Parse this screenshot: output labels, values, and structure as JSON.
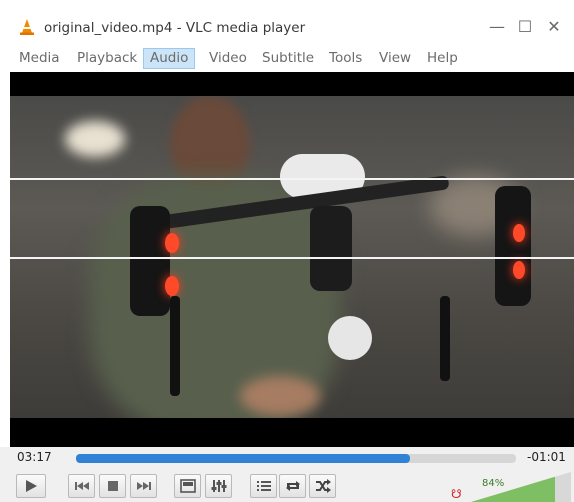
{
  "window": {
    "title": "original_video.mp4 - VLC media player",
    "controls": [
      "minimize-icon",
      "maximize-icon",
      "close-icon"
    ]
  },
  "menu": {
    "items": [
      "Media",
      "Playback",
      "Audio",
      "Video",
      "Subtitle",
      "Tools",
      "View",
      "Help"
    ],
    "active": "Audio"
  },
  "player": {
    "elapsed": "03:17",
    "remaining": "-01:01",
    "progress": 0.76,
    "volume_label": "84%",
    "volume": 0.84
  },
  "icons": {
    "app": "vlc-cone-icon",
    "play": "play-icon",
    "prev": "previous-icon",
    "stop": "stop-icon",
    "next": "next-icon",
    "fullscreen": "fullscreen-icon",
    "ext": "extended-settings-icon",
    "playlist": "playlist-icon",
    "loop": "loop-icon",
    "shuffle": "shuffle-icon",
    "mute": "volume-icon"
  },
  "colors": {
    "accent": "#2f82d6",
    "menu_active": "#cce4f7",
    "volume": "#3a7d2a"
  }
}
